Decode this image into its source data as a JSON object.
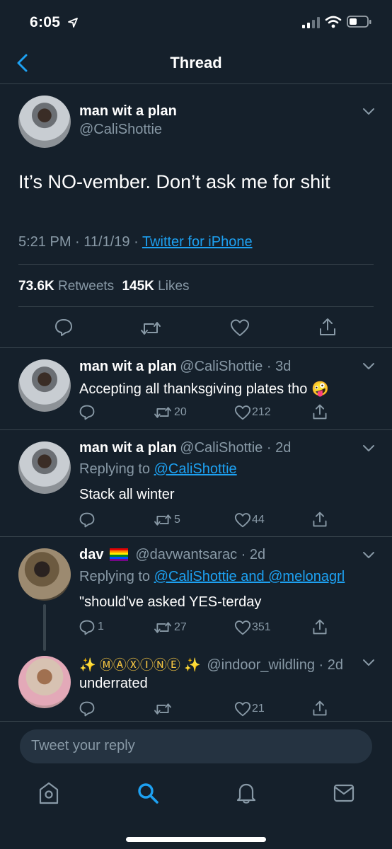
{
  "status_bar": {
    "time": "6:05"
  },
  "header": {
    "title": "Thread"
  },
  "main_tweet": {
    "name": "man wit a plan",
    "handle": "@CaliShottie",
    "text": "It’s NO-vember. Don’t ask me for shit",
    "time": "5:21 PM",
    "date": "11/1/19",
    "source": "Twitter for iPhone",
    "retweets_count": "73.6K",
    "retweets_label": "Retweets",
    "likes_count": "145K",
    "likes_label": "Likes"
  },
  "replies": [
    {
      "name": "man wit a plan",
      "handle": "@CaliShottie",
      "age": "3d",
      "text": "Accepting all thanksgiving plates tho",
      "emoji": "🤪",
      "replies_count": "",
      "retweets": "20",
      "likes": "212"
    },
    {
      "name": "man wit a plan",
      "handle": "@CaliShottie",
      "age": "2d",
      "replying_prefix": "Replying to",
      "replying_to": "@CaliShottie",
      "text": "Stack all winter",
      "replies_count": "",
      "retweets": "5",
      "likes": "44"
    },
    {
      "name": "dav",
      "handle": "@davwantsarac",
      "age": "2d",
      "replying_prefix": "Replying to",
      "replying_to": "@CaliShottie and @melonagrl",
      "text": "\"should've asked YES-terday",
      "replies_count": "1",
      "retweets": "27",
      "likes": "351"
    },
    {
      "name": "✨ ⓂⒶⓍⒾⓃⒺ ✨",
      "handle": "@indoor_wildling",
      "age": "2d",
      "text": "underrated",
      "replies_count": "",
      "retweets": "",
      "likes": "21"
    }
  ],
  "composer": {
    "placeholder": "Tweet your reply"
  },
  "tabbar": {
    "items": [
      "home-icon",
      "search-icon",
      "notifications-icon",
      "messages-icon"
    ],
    "active": "search-icon"
  },
  "colors": {
    "background": "#15202b",
    "accent": "#1da1f2",
    "secondary_text": "#8899a6",
    "divider": "#38444d"
  }
}
